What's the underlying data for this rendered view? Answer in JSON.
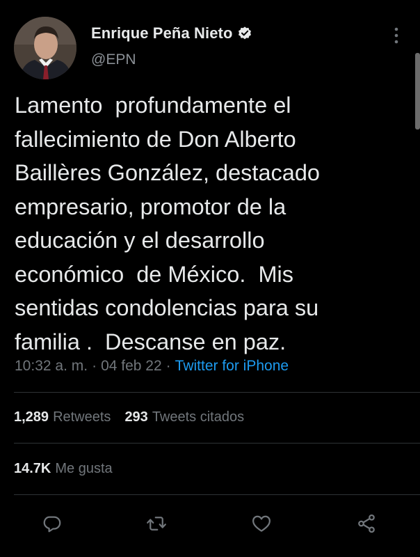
{
  "author": {
    "display_name": "Enrique Peña Nieto",
    "handle": "@EPN",
    "verified_icon": "verified-badge-icon"
  },
  "tweet": {
    "text": "Lamento  profundamente el\nfallecimiento de Don Alberto\nBaillères González, destacado\nempresario, promotor de la\neducación y el desarrollo\neconómico  de México.  Mis\nsentidas condolencias para su\nfamilia .  Descanse en paz.",
    "time": "10:32 a. m.",
    "separator": "·",
    "date": "04 feb 22",
    "source": "Twitter for iPhone"
  },
  "stats": {
    "retweets_count": "1,289",
    "retweets_label": "Retweets",
    "quotes_count": "293",
    "quotes_label": "Tweets citados",
    "likes_count": "14.7K",
    "likes_label": "Me gusta"
  },
  "actions": {
    "icons": [
      "reply-icon",
      "retweet-icon",
      "like-icon",
      "share-icon"
    ]
  },
  "colors": {
    "background": "#000000",
    "text": "#e7e9ea",
    "muted": "#71767b",
    "link": "#1d9bf0",
    "divider": "#2f3336"
  }
}
